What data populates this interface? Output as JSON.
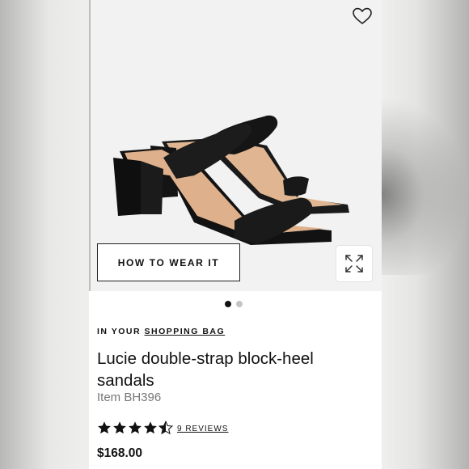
{
  "product": {
    "image_alt": "Black leather double-strap block-heel sandal",
    "how_to_wear_label": "HOW TO WEAR IT",
    "carousel": {
      "total": 2,
      "active": 1
    },
    "bag_prefix": "IN YOUR",
    "bag_link": "SHOPPING BAG",
    "title": "Lucie double-strap block-heel sandals",
    "item_number": "Item BH396",
    "rating": 4.5,
    "rating_max": 5,
    "reviews_label": "9 REVIEWS",
    "price": "$168.00"
  },
  "icons": {
    "wishlist": "heart-outline-icon",
    "expand": "expand-arrows-icon",
    "star": "star-icon"
  },
  "colors": {
    "text": "#111111",
    "muted": "#777777",
    "hero_bg": "#f2f2f2",
    "dot_inactive": "#c4c4c4"
  }
}
